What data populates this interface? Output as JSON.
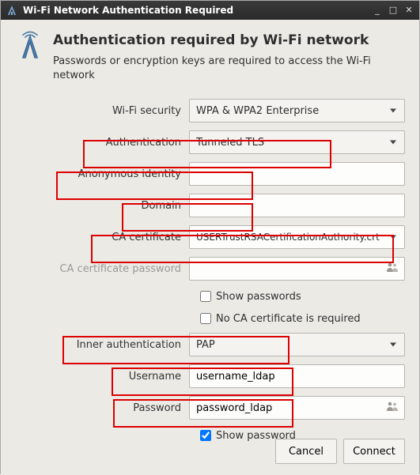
{
  "window": {
    "title": "Wi-Fi Network Authentication Required"
  },
  "header": {
    "heading": "Authentication required by Wi-Fi network",
    "description": "Passwords or encryption keys are required to access the Wi-Fi network"
  },
  "form": {
    "wifi_security": {
      "label": "Wi-Fi security",
      "value": "WPA & WPA2 Enterprise"
    },
    "authentication": {
      "label": "Authentication",
      "value": "Tunneled TLS"
    },
    "anonymous_identity": {
      "label": "Anonymous identity",
      "value": ""
    },
    "domain": {
      "label": "Domain",
      "value": ""
    },
    "ca_certificate": {
      "label": "CA certificate",
      "value": "USERTrustRSACertificationAuthority.crt"
    },
    "ca_cert_password": {
      "label": "CA certificate password",
      "value": ""
    },
    "show_passwords": {
      "label": "Show passwords",
      "checked": false
    },
    "no_ca_required": {
      "label": "No CA certificate is required",
      "checked": false
    },
    "inner_auth": {
      "label": "Inner authentication",
      "value": "PAP"
    },
    "username": {
      "label": "Username",
      "value": "username_ldap"
    },
    "password": {
      "label": "Password",
      "value": "password_ldap"
    },
    "show_password": {
      "label": "Show password",
      "checked": true
    }
  },
  "buttons": {
    "cancel": "Cancel",
    "connect": "Connect"
  }
}
